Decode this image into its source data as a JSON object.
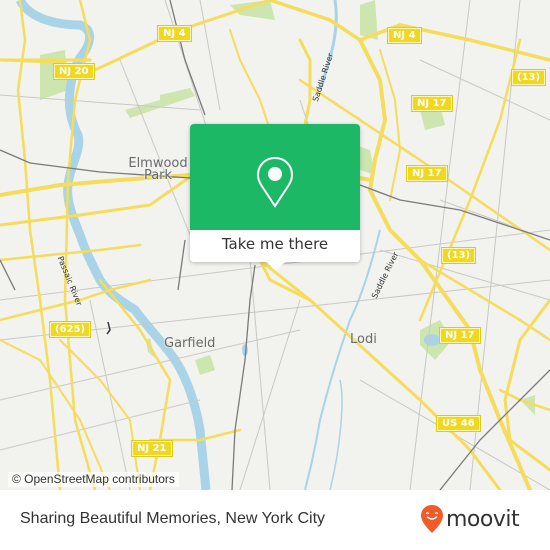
{
  "map": {
    "shields": [
      {
        "label": "NJ 4",
        "id": "nj4-west"
      },
      {
        "label": "NJ 20",
        "id": "nj20"
      },
      {
        "label": "NJ 4",
        "id": "nj4-east"
      },
      {
        "label": "(13)",
        "id": "cr13-north"
      },
      {
        "label": "NJ 17",
        "id": "nj17-north"
      },
      {
        "label": "NJ 17",
        "id": "nj17-mid"
      },
      {
        "label": "(13)",
        "id": "cr13-mid"
      },
      {
        "label": "(625)",
        "id": "cr625"
      },
      {
        "label": "NJ 17",
        "id": "nj17-south"
      },
      {
        "label": "US 46",
        "id": "us46"
      },
      {
        "label": "NJ 21",
        "id": "nj21"
      }
    ],
    "places": {
      "elmwood_line1": "Elmwood",
      "elmwood_line2": "Park",
      "garfield": "Garfield",
      "lodi": "Lodi"
    },
    "rivers": {
      "passaic": "Passaic River",
      "saddle_north": "Saddle River",
      "saddle_south": "Saddle River"
    },
    "colors": {
      "background": "#f2f2ef",
      "road": "#f5dc5a",
      "water": "#a9d3e6",
      "park": "#cde6b0",
      "rail": "#777777"
    },
    "attribution": "© OpenStreetMap contributors"
  },
  "popup": {
    "icon": "map-pin-icon",
    "button_label": "Take me there",
    "accent_color": "#1db866"
  },
  "footer": {
    "title": "Sharing Beautiful Memories, New York City",
    "brand": "moovit",
    "brand_icon": "moovit-smiley-pin-icon",
    "brand_color": "#f15a29"
  }
}
